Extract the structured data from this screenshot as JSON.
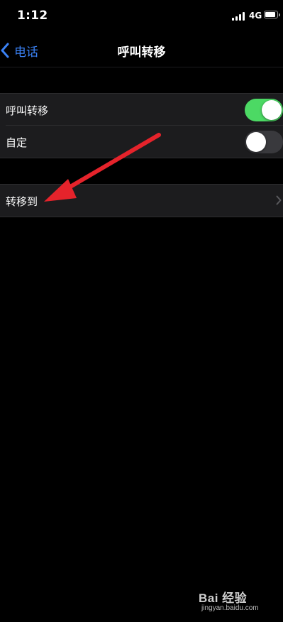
{
  "status_bar": {
    "time": "1:12",
    "network": "4G",
    "signal_bars": 4,
    "battery_level": 0.85
  },
  "nav": {
    "back_label": "电话",
    "title": "呼叫转移"
  },
  "settings": {
    "call_forwarding": {
      "label": "呼叫转移",
      "on": true
    },
    "custom": {
      "label": "自定",
      "on": false
    },
    "forward_to": {
      "label": "转移到"
    }
  },
  "colors": {
    "accent": "#3b82f6",
    "toggle_on": "#4cd964",
    "toggle_off": "#39393d",
    "annotation_arrow": "#e5232b"
  },
  "watermark": {
    "brand": "Bai 经验",
    "domain": "jingyan.baidu.com"
  }
}
